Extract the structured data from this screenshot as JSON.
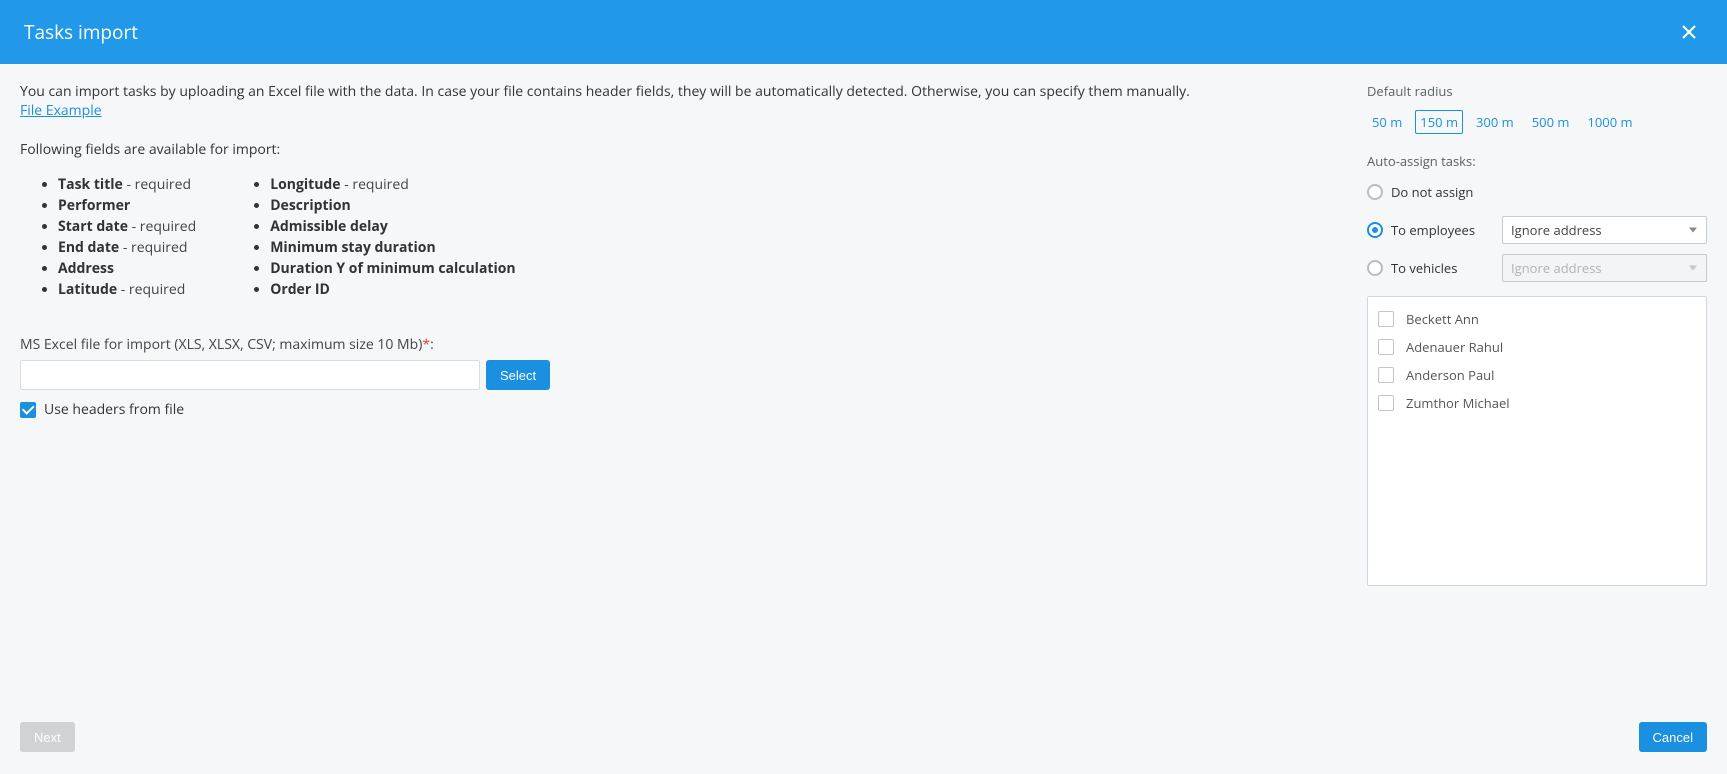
{
  "header": {
    "title": "Tasks import"
  },
  "intro": {
    "text": "You can import tasks by uploading an Excel file with the data. In case your file contains header fields, they will be automatically detected. Otherwise, you can specify them manually.",
    "file_example": "File Example"
  },
  "fields_intro": "Following fields are available for import:",
  "fields_col1": [
    {
      "name": "Task title",
      "req": " - required"
    },
    {
      "name": "Performer",
      "req": ""
    },
    {
      "name": "Start date",
      "req": " - required"
    },
    {
      "name": "End date",
      "req": " - required"
    },
    {
      "name": "Address",
      "req": ""
    },
    {
      "name": "Latitude",
      "req": " - required"
    }
  ],
  "fields_col2": [
    {
      "name": "Longitude",
      "req": " - required"
    },
    {
      "name": "Description",
      "req": ""
    },
    {
      "name": "Admissible delay",
      "req": ""
    },
    {
      "name": "Minimum stay duration",
      "req": ""
    },
    {
      "name": "Duration Y of minimum calculation",
      "req": ""
    },
    {
      "name": "Order ID",
      "req": ""
    }
  ],
  "file": {
    "label": "MS Excel file for import (XLS, XLSX, CSV; maximum size 10 Mb)",
    "asterisk": "*",
    "colon": ":",
    "value": "",
    "select_label": "Select"
  },
  "use_headers": {
    "label": "Use headers from file",
    "checked": true
  },
  "right": {
    "default_radius_label": "Default radius",
    "radii": [
      "50 m",
      "150 m",
      "300 m",
      "500 m",
      "1000 m"
    ],
    "radius_selected": 1,
    "auto_assign_label": "Auto-assign tasks:",
    "options": {
      "no_assign": "Do not assign",
      "to_employees": "To employees",
      "to_vehicles": "To vehicles"
    },
    "selected_option": "to_employees",
    "employees_select_value": "Ignore address",
    "vehicles_select_value": "Ignore address",
    "people": [
      "Beckett Ann",
      "Adenauer Rahul",
      "Anderson Paul",
      "Zumthor Michael"
    ]
  },
  "footer": {
    "next": "Next",
    "cancel": "Cancel"
  }
}
